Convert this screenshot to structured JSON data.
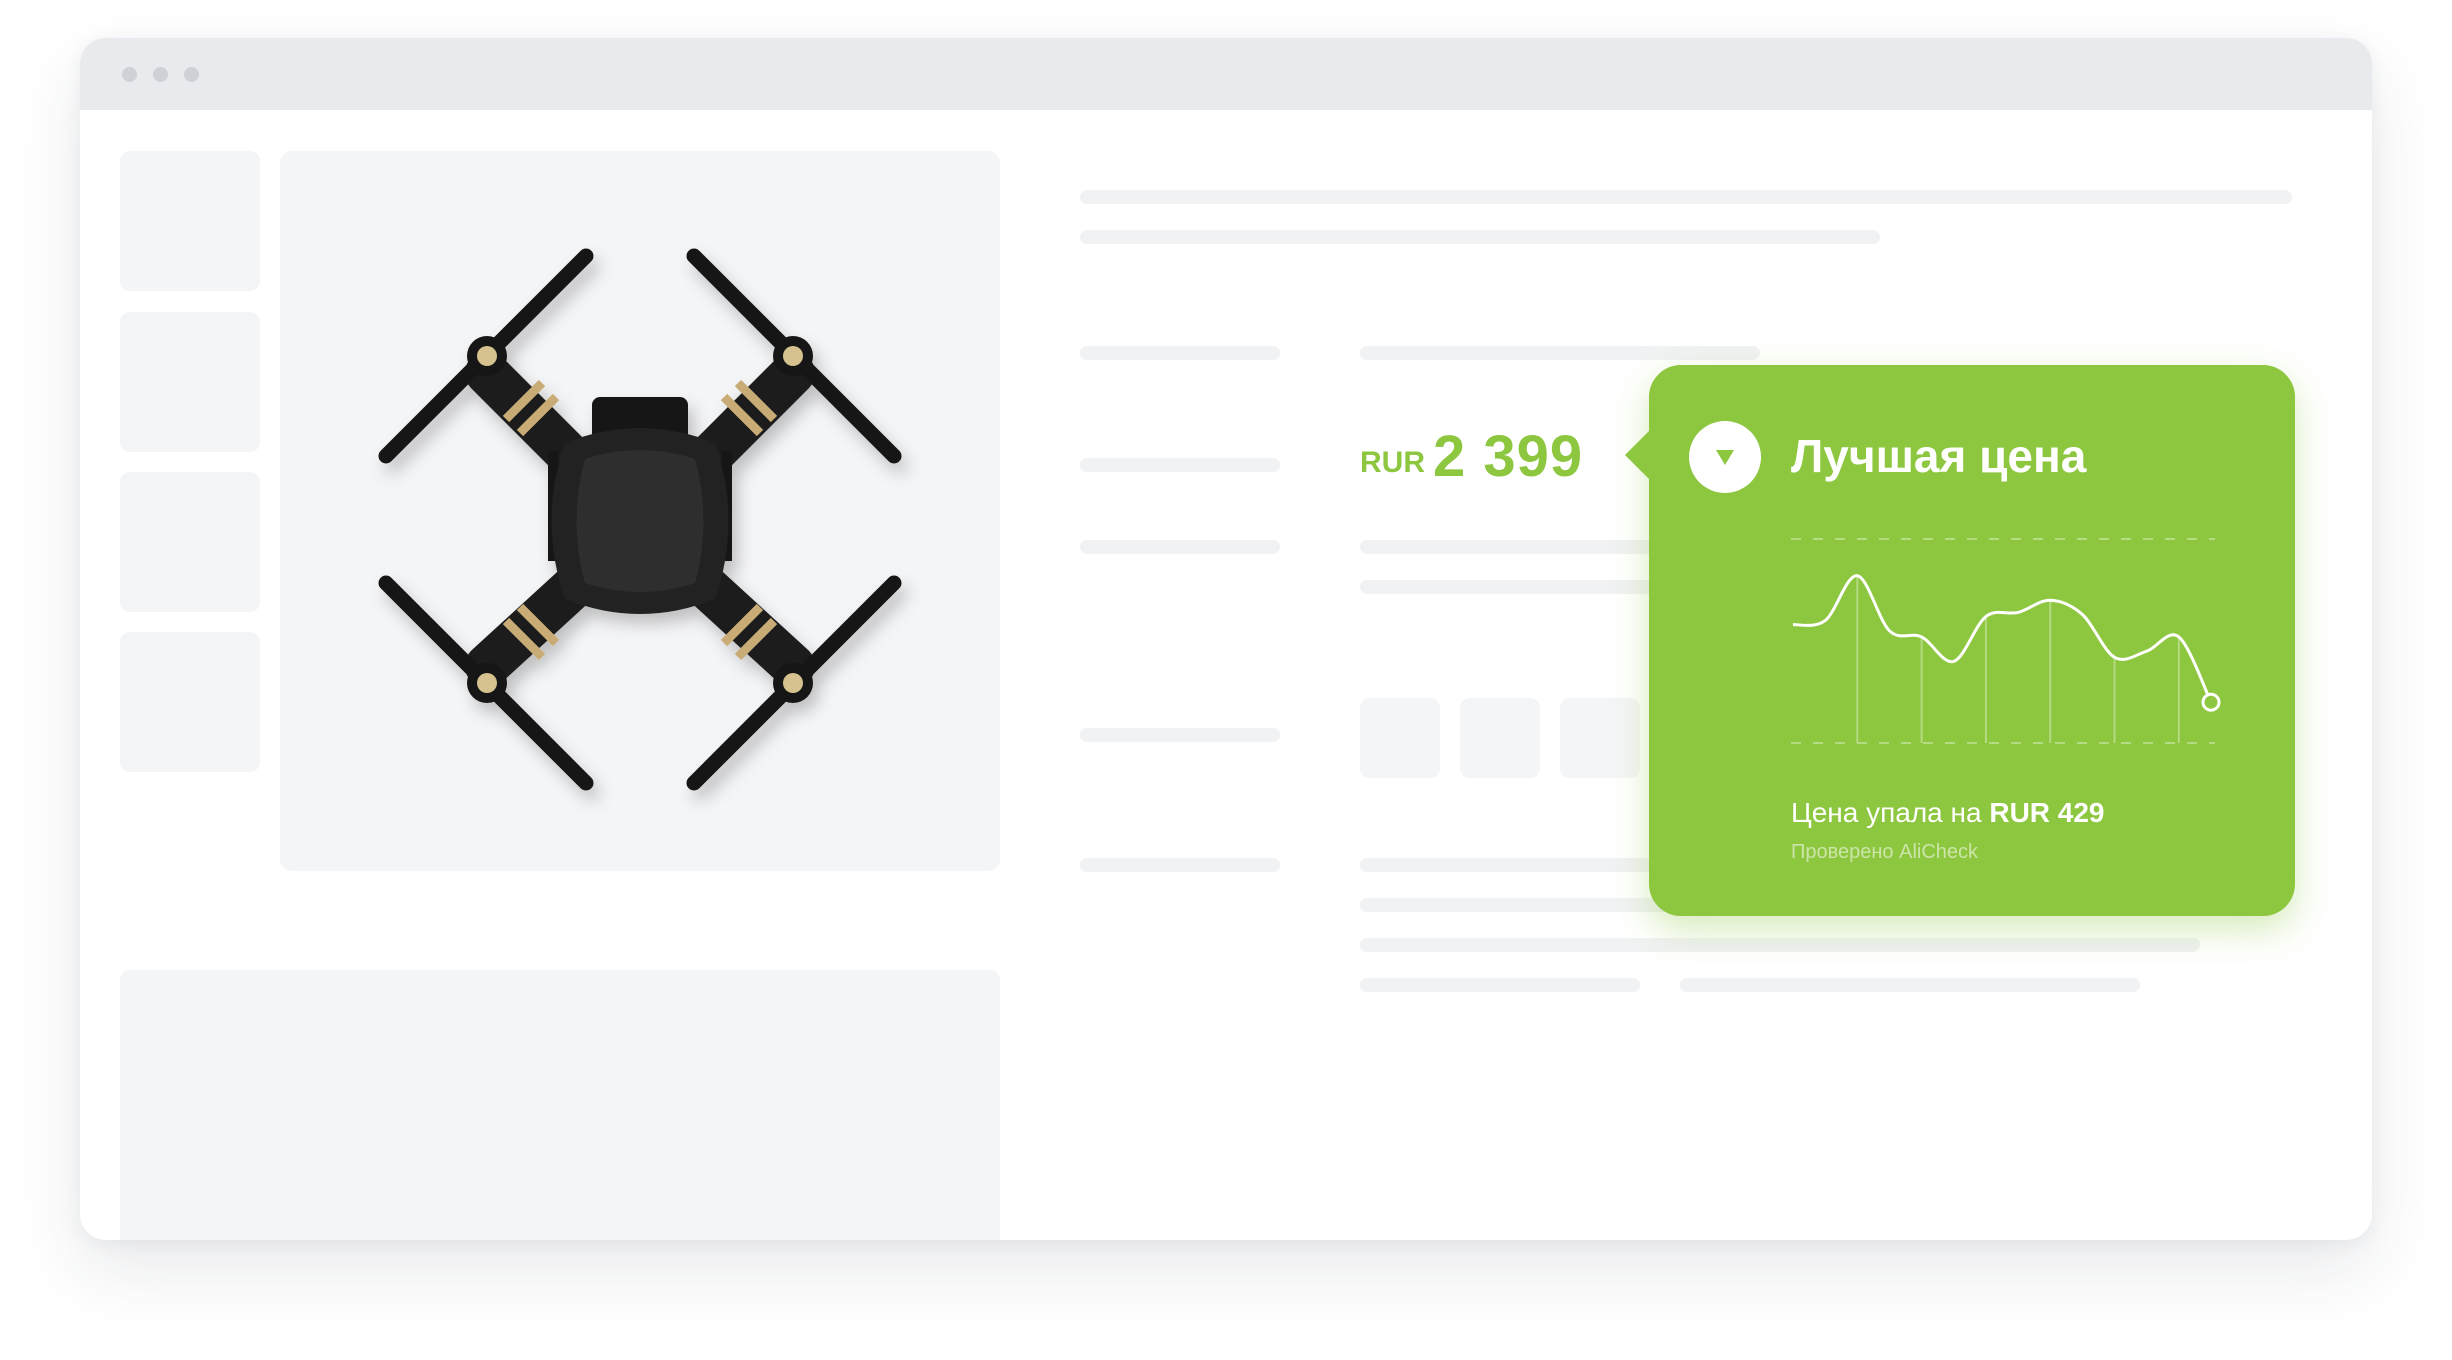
{
  "window": {
    "controls": [
      "window-dot",
      "window-dot",
      "window-dot"
    ]
  },
  "product": {
    "image_icon": "drone-image",
    "price": {
      "currency": "RUR",
      "amount": "2 399"
    }
  },
  "popup": {
    "icon": "price-down-icon",
    "title": "Лучшая цена",
    "drop_text": "Цена упала на",
    "drop_amount": "RUR 429",
    "verified": "Проверено AliCheck"
  },
  "colors": {
    "accent": "#8dc63f",
    "placeholder": "#f4f5f7",
    "titlebar": "#e9eaee"
  },
  "chart_data": {
    "type": "line",
    "x": [
      0,
      1,
      2,
      3,
      4,
      5,
      6,
      7,
      8,
      9,
      10,
      11,
      12,
      13
    ],
    "values": [
      0.58,
      0.6,
      0.82,
      0.55,
      0.52,
      0.4,
      0.62,
      0.64,
      0.7,
      0.63,
      0.42,
      0.45,
      0.52,
      0.2
    ],
    "title": "",
    "xlabel": "",
    "ylabel": "",
    "ylim": [
      0,
      1
    ],
    "grid": true
  }
}
